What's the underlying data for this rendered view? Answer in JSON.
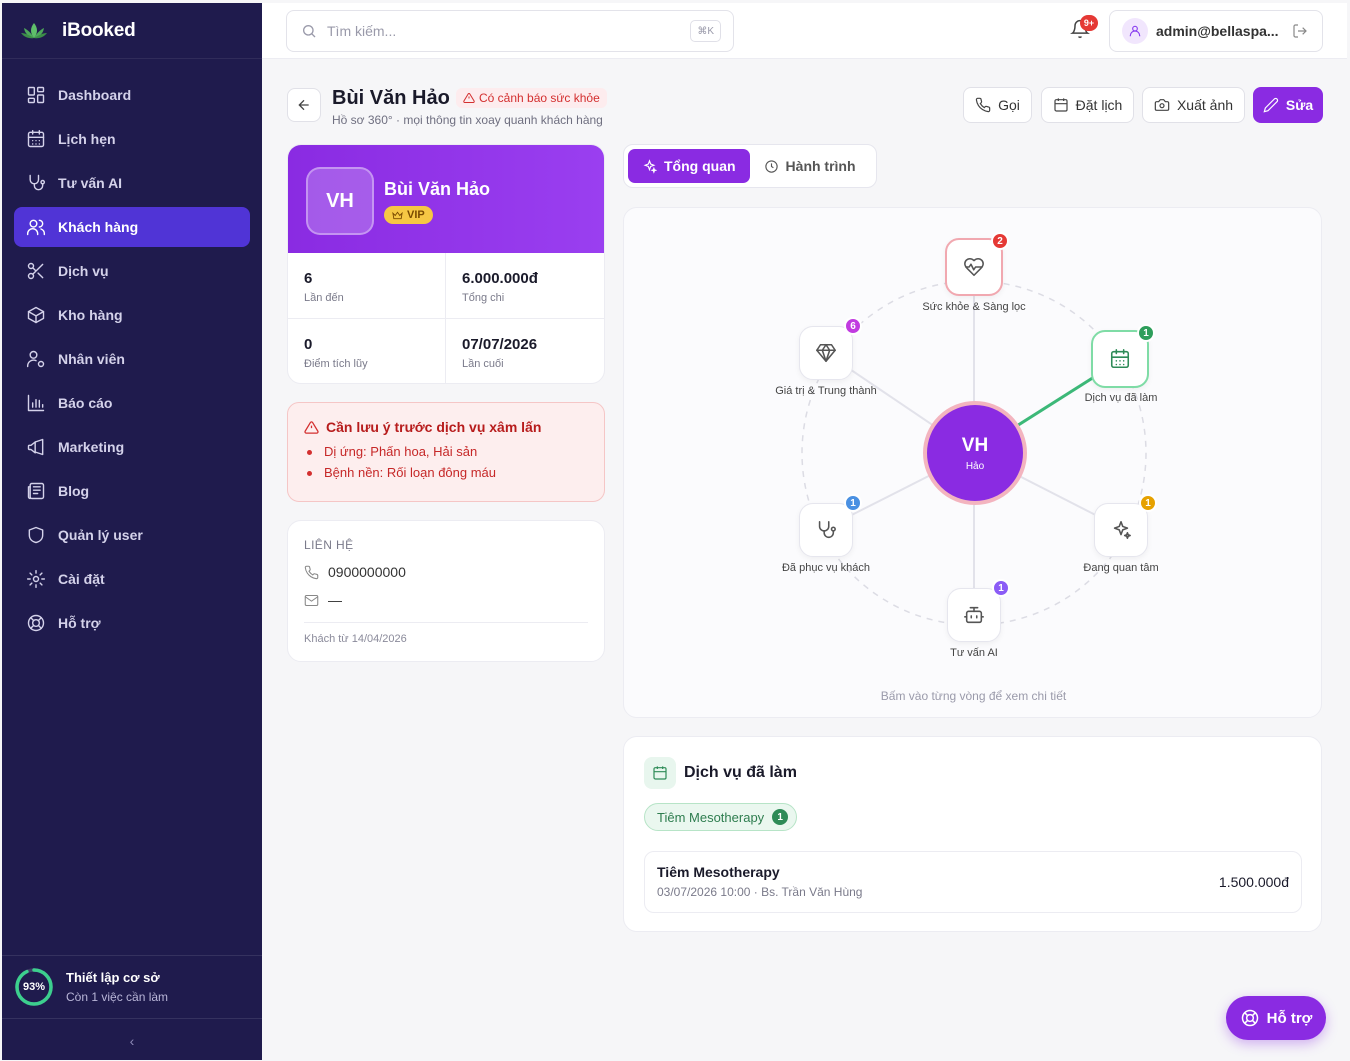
{
  "app": {
    "name": "iBooked"
  },
  "sidebar": {
    "items": [
      {
        "label": "Dashboard",
        "icon": "dashboard-icon"
      },
      {
        "label": "Lịch hẹn",
        "icon": "calendar-icon"
      },
      {
        "label": "Tư vấn AI",
        "icon": "stethoscope-icon"
      },
      {
        "label": "Khách hàng",
        "icon": "users-icon",
        "active": true
      },
      {
        "label": "Dịch vụ",
        "icon": "scissors-icon"
      },
      {
        "label": "Kho hàng",
        "icon": "package-icon"
      },
      {
        "label": "Nhân viên",
        "icon": "user-gear-icon"
      },
      {
        "label": "Báo cáo",
        "icon": "bar-chart-icon"
      },
      {
        "label": "Marketing",
        "icon": "megaphone-icon"
      },
      {
        "label": "Blog",
        "icon": "newspaper-icon"
      },
      {
        "label": "Quản lý user",
        "icon": "shield-icon"
      },
      {
        "label": "Cài đặt",
        "icon": "gear-icon"
      },
      {
        "label": "Hỗ trợ",
        "icon": "lifebuoy-icon"
      }
    ],
    "setup": {
      "percent_label": "93%",
      "progress": 0.93,
      "title": "Thiết lập cơ sở",
      "subtitle": "Còn 1 việc cần làm"
    },
    "collapse_glyph": "‹"
  },
  "topbar": {
    "search_placeholder": "Tìm kiếm...",
    "search_shortcut": "⌘K",
    "notification_count": "9+",
    "user_email": "admin@bellaspa..."
  },
  "header": {
    "title": "Bùi Văn Hảo",
    "warning_badge": "Có cảnh báo sức khỏe",
    "subtitle": "Hồ sơ 360° · mọi thông tin xoay quanh khách hàng",
    "buttons": {
      "call": "Gọi",
      "book": "Đặt lịch",
      "export": "Xuất ảnh",
      "edit": "Sửa"
    }
  },
  "profile": {
    "initials": "VH",
    "name": "Bùi Văn Hảo",
    "tier": "VIP",
    "stats": [
      {
        "value": "6",
        "label": "Lần đến"
      },
      {
        "value": "6.000.000đ",
        "label": "Tổng chi"
      },
      {
        "value": "0",
        "label": "Điểm tích lũy"
      },
      {
        "value": "07/07/2026",
        "label": "Lần cuối"
      }
    ]
  },
  "alert": {
    "title": "Cần lưu ý trước dịch vụ xâm lấn",
    "items": [
      "Dị ứng: Phấn hoa, Hải sản",
      "Bệnh nền: Rối loạn đông máu"
    ]
  },
  "contact": {
    "heading": "LIÊN HỆ",
    "phone": "0900000000",
    "email": "—",
    "since": "Khách từ 14/04/2026"
  },
  "tabs": [
    {
      "label": "Tổng quan",
      "active": true
    },
    {
      "label": "Hành trình",
      "active": false
    }
  ],
  "graph": {
    "center": {
      "initials": "VH",
      "name": "Hảo"
    },
    "nodes": [
      {
        "label": "Sức khỏe & Sàng lọc",
        "count": "2",
        "badge_color": "#e53935",
        "icon": "heart-pulse-icon"
      },
      {
        "label": "Dịch vụ đã làm",
        "count": "1",
        "badge_color": "#2e9e5b",
        "icon": "calendar-icon"
      },
      {
        "label": "Đang quan tâm",
        "count": "1",
        "badge_color": "#e6a100",
        "icon": "sparkles-icon"
      },
      {
        "label": "Tư vấn AI",
        "count": "1",
        "badge_color": "#8b5cf6",
        "icon": "bot-icon"
      },
      {
        "label": "Đã phục vụ khách",
        "count": "1",
        "badge_color": "#4a90e2",
        "icon": "stethoscope-icon"
      },
      {
        "label": "Giá trị & Trung thành",
        "count": "6",
        "badge_color": "#c13be0",
        "icon": "diamond-icon"
      }
    ],
    "hint": "Bấm vào từng vòng để xem chi tiết"
  },
  "services": {
    "title": "Dịch vụ đã làm",
    "chip": {
      "label": "Tiêm Mesotherapy",
      "count": "1"
    },
    "rows": [
      {
        "name": "Tiêm Mesotherapy",
        "meta": "03/07/2026 10:00 · Bs. Trần Văn Hùng",
        "price": "1.500.000đ"
      }
    ]
  },
  "support_button": "Hỗ trợ",
  "colors": {
    "sidebar_bg": "#1f1b4d",
    "accent": "#8a2be2",
    "nav_active": "#5034d6",
    "danger": "#d32f2f",
    "success": "#2e8b57"
  }
}
